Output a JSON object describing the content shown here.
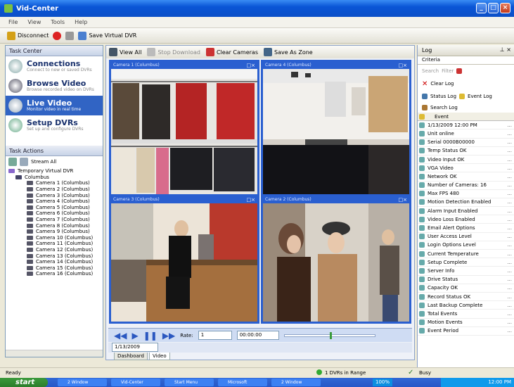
{
  "window": {
    "title": "Vid-Center"
  },
  "menu": [
    "File",
    "View",
    "Tools",
    "Help"
  ],
  "toolbar": {
    "disconnect_label": "Disconnect",
    "virtual_dvr_label": "Save Virtual DVR"
  },
  "left": {
    "task_center_label": "Task Center",
    "tasks": [
      {
        "title": "Connections",
        "subtitle": "Connect to new or saved DVRs"
      },
      {
        "title": "Browse Video",
        "subtitle": "Browse recorded video on DVRs"
      },
      {
        "title": "Live Video",
        "subtitle": "Monitor video in real time"
      },
      {
        "title": "Setup DVRs",
        "subtitle": "Set up and configure DVRs"
      }
    ],
    "task_actions_label": "Task Actions",
    "actions_button": "Stream All",
    "tree_root": "Temporary Virtual DVR",
    "tree_site": "Columbus",
    "cameras": [
      "Camera 1 (Columbus)",
      "Camera 2 (Columbus)",
      "Camera 3 (Columbus)",
      "Camera 4 (Columbus)",
      "Camera 5 (Columbus)",
      "Camera 6 (Columbus)",
      "Camera 7 (Columbus)",
      "Camera 8 (Columbus)",
      "Camera 9 (Columbus)",
      "Camera 10 (Columbus)",
      "Camera 11 (Columbus)",
      "Camera 12 (Columbus)",
      "Camera 13 (Columbus)",
      "Camera 14 (Columbus)",
      "Camera 15 (Columbus)",
      "Camera 16 (Columbus)"
    ]
  },
  "center": {
    "vtoolbar": {
      "view_all": "View All",
      "stop_download": "Stop Download",
      "clear_cameras": "Clear Cameras",
      "save_as_zone": "Save As Zone"
    },
    "videos": [
      {
        "title": "Camera 1 (Columbus)"
      },
      {
        "title": "Camera 4 (Columbus)"
      },
      {
        "title": "Camera 3 (Columbus)"
      },
      {
        "title": "Camera 2 (Columbus)"
      }
    ],
    "player": {
      "rate_label": "Rate:",
      "rate_value": "1",
      "time_value": "00:00:00",
      "date_value": "1/13/2009"
    },
    "tabs": [
      "Dashboard",
      "Video"
    ]
  },
  "log": {
    "title": "Log",
    "tab": "Criteria",
    "search_label": "Search",
    "filter_label": "Filter",
    "clear_log_label": "Clear Log",
    "status_log_label": "Status Log",
    "event_log_label": "Event Log",
    "search_log_label": "Search Log",
    "column_header": "Event",
    "entries": [
      "1/13/2009 12:00 PM",
      "Unit online",
      "Serial 0000B00000",
      "Temp Status OK",
      "Video Input OK",
      "VGA Video",
      "Network OK",
      "Number of Cameras: 16",
      "Max FPS 480",
      "Motion Detection Enabled",
      "Alarm Input Enabled",
      "Video Loss Enabled",
      "Email Alert Options",
      "User Access Level",
      "Login Options Level",
      "Current Temperature",
      "Setup Complete",
      "Server Info",
      "Drive Status",
      "Capacity OK",
      "Record Status OK",
      "Last Backup Complete",
      "Total Events",
      "Motion Events",
      "Event Period"
    ]
  },
  "status": {
    "left": "Ready",
    "middle": "1 DVRs in Range",
    "right": "Busy"
  },
  "taskbar": {
    "start_label": "start",
    "buttons": [
      "2 Window",
      "Vid-Center",
      "Start Menu",
      "Microsoft",
      "2 Window"
    ],
    "percent": "100%",
    "clock": "12:00 PM"
  },
  "colors": {
    "accent": "#3164c4",
    "title_bar": "#0a55d6",
    "video_border": "#2a5fd0"
  }
}
